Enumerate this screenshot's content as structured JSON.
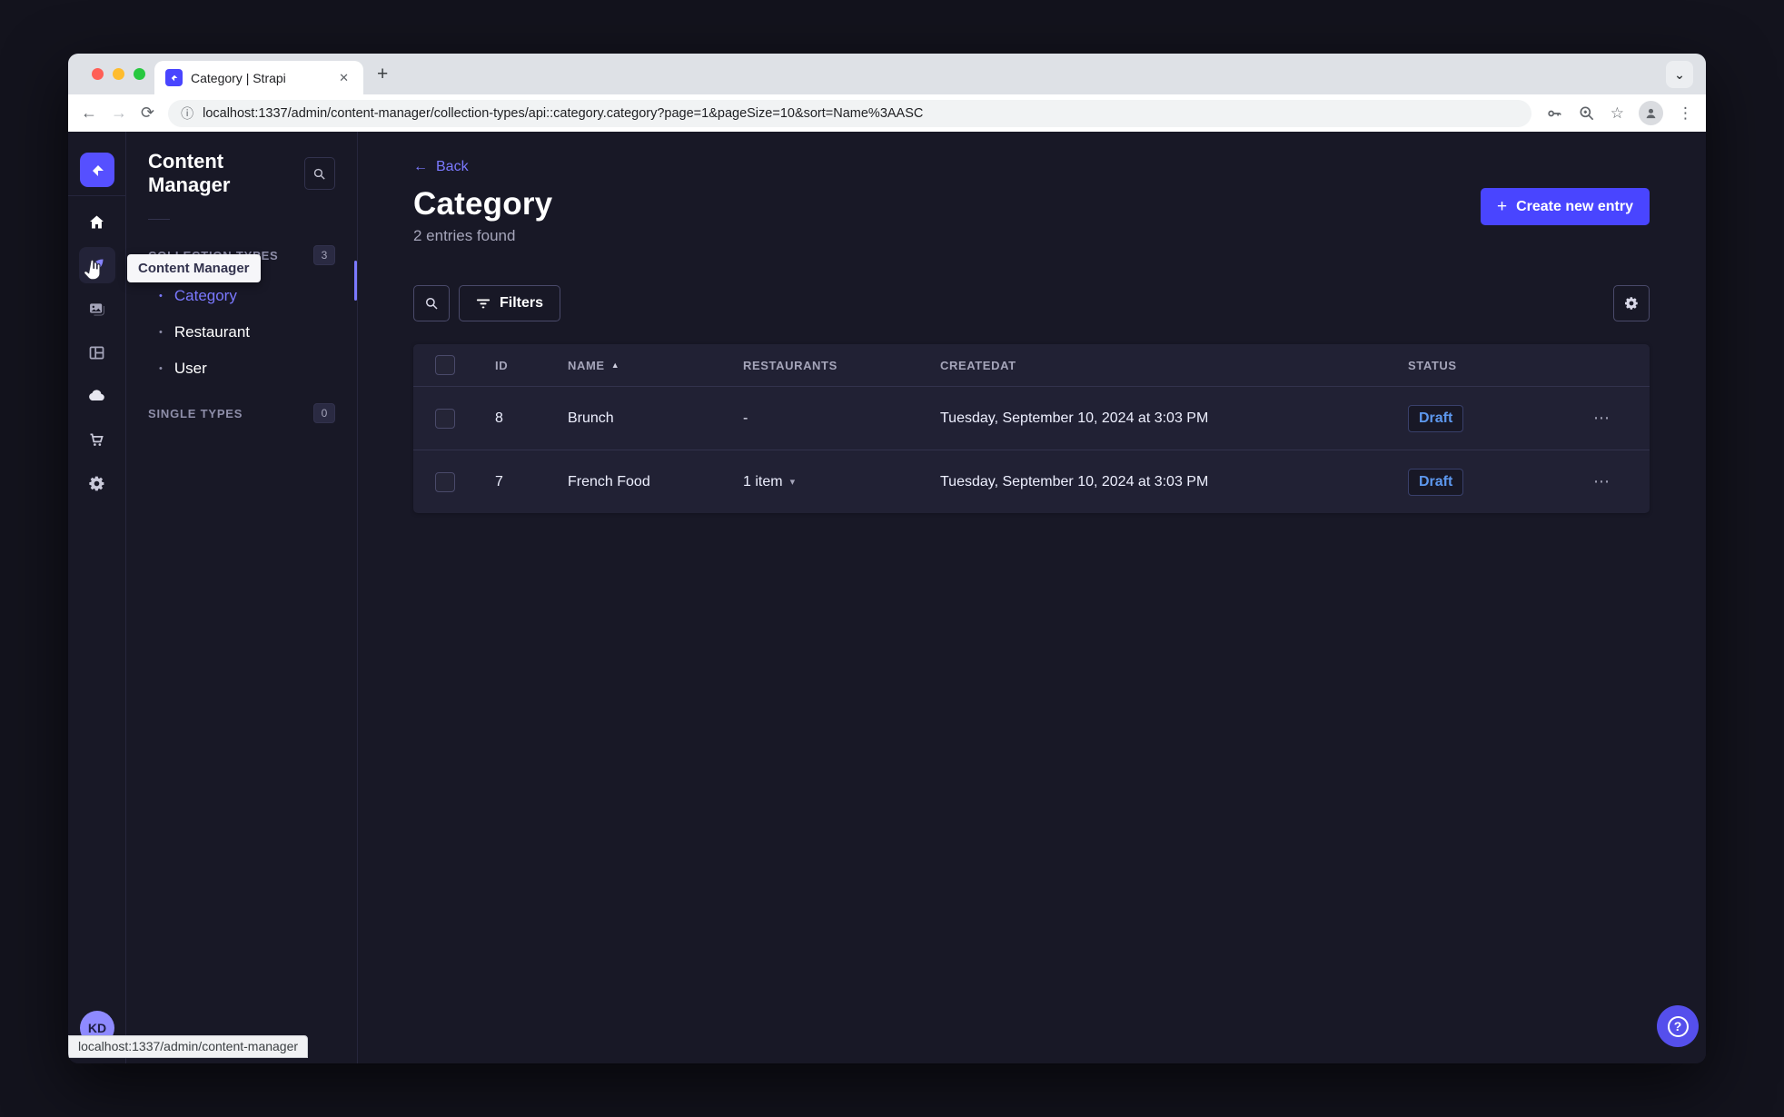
{
  "browser": {
    "tab_title": "Category | Strapi",
    "url": "localhost:1337/admin/content-manager/collection-types/api::category.category?page=1&pageSize=10&sort=Name%3AASC"
  },
  "icons": {
    "close": "✕",
    "plus": "+",
    "chevron_down": "⌄",
    "caret_down": "▾",
    "sort_asc": "▲",
    "arrow_left": "←",
    "arrow_right": "→",
    "reload": "⟳",
    "info": "ⓘ",
    "star": "☆",
    "kebab": "⋮",
    "ellipsis": "⋯",
    "bullet": "●",
    "question": "?"
  },
  "sidebar": {
    "workspace_tooltip": "Content Manager",
    "avatar_initials": "KD",
    "status_url": "localhost:1337/admin/content-manager"
  },
  "panel": {
    "title": "Content Manager",
    "collection_section": {
      "label": "COLLECTION TYPES",
      "count": "3",
      "items": [
        {
          "label": "Category"
        },
        {
          "label": "Restaurant"
        },
        {
          "label": "User"
        }
      ]
    },
    "single_section": {
      "label": "SINGLE TYPES",
      "count": "0"
    }
  },
  "main": {
    "back_label": "Back",
    "title": "Category",
    "subtitle": "2 entries found",
    "create_button": "Create new entry",
    "filters_button": "Filters"
  },
  "table": {
    "headers": [
      "ID",
      "NAME",
      "RESTAURANTS",
      "CREATEDAT",
      "STATUS"
    ],
    "rows": [
      {
        "id": "8",
        "name": "Brunch",
        "restaurants": "-",
        "created": "Tuesday, September 10, 2024 at 3:03 PM",
        "status": "Draft"
      },
      {
        "id": "7",
        "name": "French Food",
        "restaurants": "1 item",
        "created": "Tuesday, September 10, 2024 at 3:03 PM",
        "status": "Draft"
      }
    ]
  },
  "colors": {
    "accent": "#4945ff",
    "link": "#7b79ff",
    "page_bg": "#181826",
    "card_bg": "#212134",
    "draft_text": "#5d98ee"
  }
}
